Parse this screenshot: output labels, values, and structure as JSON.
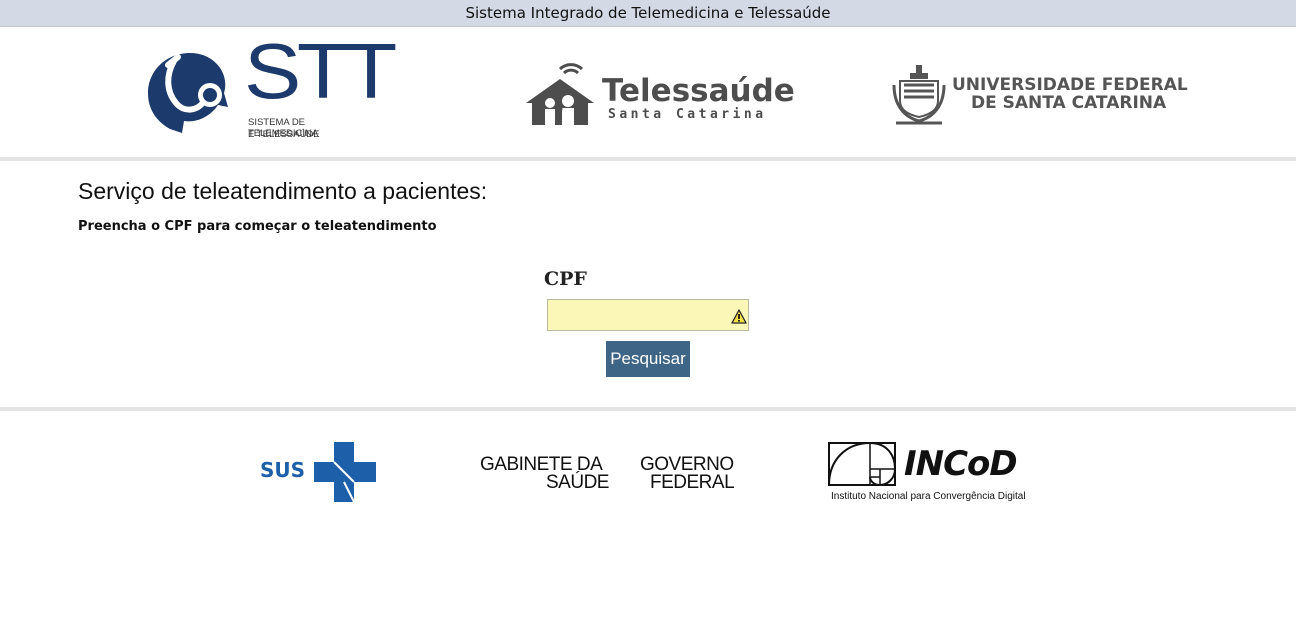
{
  "top_bar": {
    "title": "Sistema Integrado de Telemedicina e Telessaúde"
  },
  "header_logos": {
    "stt": {
      "acronym": "STT",
      "line1": "SISTEMA DE TELEMEDICINA",
      "line2": "E TELESSAÚDE",
      "icon": "stt-stethoscope-icon"
    },
    "telessaude": {
      "name": "Telessaúde",
      "region": "Santa Catarina",
      "icon": "house-family-icon"
    },
    "ufsc": {
      "line1": "UNIVERSIDADE FEDERAL",
      "line2": "DE SANTA CATARINA",
      "icon": "ufsc-crest-icon"
    }
  },
  "main": {
    "title": "Serviço de teleatendimento a pacientes:",
    "subtitle": "Preencha o CPF para começar o teleatendimento"
  },
  "form": {
    "cpf_label": "CPF",
    "cpf_value": "",
    "cpf_placeholder": "",
    "search_label": "Pesquisar",
    "warning_icon": "warning-icon"
  },
  "footer_logos": {
    "sus": {
      "text": "SUS",
      "icon": "sus-cross-icon"
    },
    "gabinete": {
      "line1": "GABINETE DA",
      "line2": "SAÚDE"
    },
    "governo": {
      "line1": "GOVERNO",
      "line2": "FEDERAL"
    },
    "incod": {
      "name": "INCoD",
      "subtitle": "Instituto Nacional para Convergência Digital",
      "icon": "golden-spiral-icon"
    }
  },
  "colors": {
    "stt_blue": "#1c3a6b",
    "gray_logo": "#4d4d4d",
    "sus_blue": "#1d5fa8",
    "button_bg": "#3f6586",
    "input_bg": "#fbf8b7",
    "top_bar_bg": "#d3dae5"
  }
}
